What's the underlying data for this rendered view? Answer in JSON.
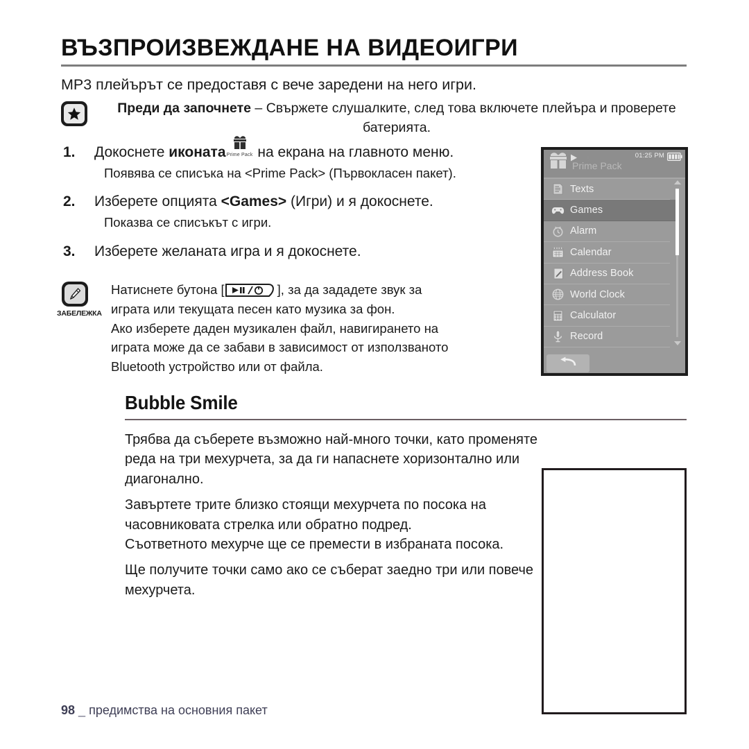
{
  "page": {
    "title": "ВЪЗПРОИЗВЕЖДАНЕ НА ВИДЕОИГРИ",
    "intro": "MP3 плейърът се предоставя с вече заредени на него игри."
  },
  "before_you_start": {
    "icon": "star-icon",
    "label": "Преди да започнете",
    "dash": " – ",
    "text": "Свържете слушалките, след това включете плейъра и проверете батерията."
  },
  "steps": [
    {
      "num": "1.",
      "text_before": "Докоснете ",
      "bold": "иконата",
      "icon_caption": "Prime Pack",
      "text_after": " на екрана на главното меню.",
      "sub": "Появява се списъка на <Prime Pack> (Първокласен пакет)."
    },
    {
      "num": "2.",
      "text_before": "Изберете опцията ",
      "bold": "<Games>",
      "text_after": " (Игри) и я докоснете.",
      "sub": "Показва се списъкът с игри."
    },
    {
      "num": "3.",
      "text_before": "Изберете желаната игра и я докоснете.",
      "bold": "",
      "text_after": "",
      "sub": ""
    }
  ],
  "note": {
    "badge_label": "ЗАБЕЛЕЖКА",
    "line1_before": "Натиснете бутона [",
    "button_glyph": "▶II / ⏻",
    "line1_after": "], за да зададете звук за",
    "line2": "играта или текущата песен като музика за фон.",
    "line3": "Ако изберете даден музикален файл, навигирането на",
    "line4": "играта може да се забави в зависимост от използваното",
    "line5": "Bluetooth устройство или от файла."
  },
  "device": {
    "status": {
      "gift_icon": "gift-icon",
      "play_icon": "play-icon",
      "bluetooth_icon": "bluetooth-icon",
      "time": "01:25 PM",
      "battery_icon": "battery-icon"
    },
    "screen_title": "Prime Pack",
    "menu_items": [
      {
        "label": "Texts",
        "icon": "texts-icon",
        "selected": false
      },
      {
        "label": "Games",
        "icon": "games-icon",
        "selected": true
      },
      {
        "label": "Alarm",
        "icon": "alarm-icon",
        "selected": false
      },
      {
        "label": "Calendar",
        "icon": "calendar-icon",
        "selected": false
      },
      {
        "label": "Address Book",
        "icon": "address-book-icon",
        "selected": false
      },
      {
        "label": "World Clock",
        "icon": "world-clock-icon",
        "selected": false
      },
      {
        "label": "Calculator",
        "icon": "calculator-icon",
        "selected": false
      },
      {
        "label": "Record",
        "icon": "record-icon",
        "selected": false
      }
    ],
    "back_button_icon": "back-arrow-icon"
  },
  "section": {
    "title": "Bubble Smile",
    "paragraphs": [
      "Трябва да съберете възможно най-много точки, като променяте реда на три мехурчета, за да ги напаснете хоризонтално или диагонално.",
      "Завъртете трите близко стоящи мехурчета по посока на часовниковата стрелка или обратно подред.",
      "Съответното мехурче ще се премести в избраната посока.",
      "Ще получите точки само ако се съберат заедно три или повече мехурчета."
    ]
  },
  "footer": {
    "page_number": "98",
    "separator": "_",
    "text": "предимства на основния пакет"
  },
  "colors": {
    "title_rule": "#7d7d7d",
    "section_rule": "#6b5f63",
    "screen_bg": "#9b9b9b",
    "selection": "#797979",
    "footer_text": "#3f3f56"
  }
}
